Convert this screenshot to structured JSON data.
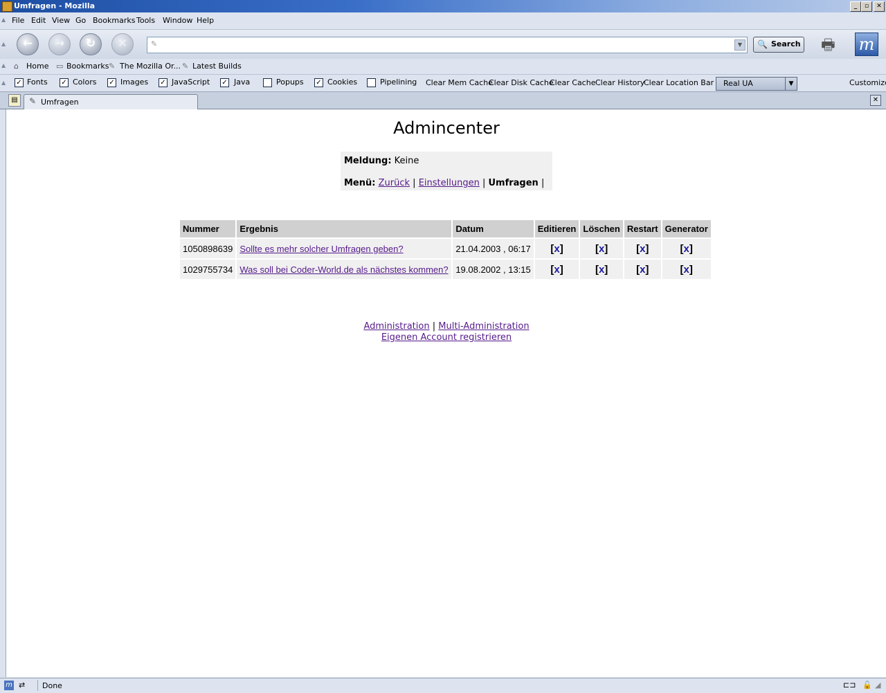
{
  "window": {
    "title": "Umfragen - Mozilla"
  },
  "menubar": {
    "items": [
      "File",
      "Edit",
      "View",
      "Go",
      "Bookmarks",
      "Tools",
      "Window",
      "Help"
    ]
  },
  "navbar": {
    "url_value": "",
    "search_label": "Search"
  },
  "personal_toolbar": {
    "items": [
      "Home",
      "Bookmarks",
      "The Mozilla Or...",
      "Latest Builds"
    ]
  },
  "prefbar": {
    "checkboxes": [
      {
        "label": "Fonts",
        "checked": true
      },
      {
        "label": "Colors",
        "checked": true
      },
      {
        "label": "Images",
        "checked": true
      },
      {
        "label": "JavaScript",
        "checked": true
      },
      {
        "label": "Java",
        "checked": true
      },
      {
        "label": "Popups",
        "checked": false
      },
      {
        "label": "Cookies",
        "checked": true
      },
      {
        "label": "Pipelining",
        "checked": false
      }
    ],
    "buttons": [
      "Clear Mem Cache",
      "Clear Disk Cache",
      "Clear Cache",
      "Clear History",
      "Clear Location Bar"
    ],
    "ua_select": "Real UA",
    "customize": "Customize"
  },
  "tab": {
    "label": "Umfragen"
  },
  "page": {
    "title": "Admincenter",
    "meldung_label": "Meldung:",
    "meldung_value": "Keine",
    "menu_label": "Menü:",
    "menu_links": [
      "Zurück",
      "Einstellungen"
    ],
    "menu_current": "Umfragen",
    "sep": "|",
    "table": {
      "headers": [
        "Nummer",
        "Ergebnis",
        "Datum",
        "Editieren",
        "Löschen",
        "Restart",
        "Generator"
      ],
      "rows": [
        {
          "nummer": "1050898639",
          "ergebnis": "Sollte es mehr solcher Umfragen geben?",
          "datum": "21.04.2003 , 06:17",
          "x": "x"
        },
        {
          "nummer": "1029755734",
          "ergebnis": "Was soll bei Coder-World.de als nächstes kommen?",
          "datum": "19.08.2002 , 13:15",
          "x": "x"
        }
      ]
    },
    "footer": {
      "admin": "Administration",
      "multi": "Multi-Administration",
      "register": "Eigenen Account registrieren"
    }
  },
  "status": {
    "text": "Done"
  },
  "colors": {
    "link": "#551a8b",
    "header_bg": "#d0d0d0",
    "cell_bg": "#f0f0f0",
    "titlebar": "#1d4ea3"
  }
}
